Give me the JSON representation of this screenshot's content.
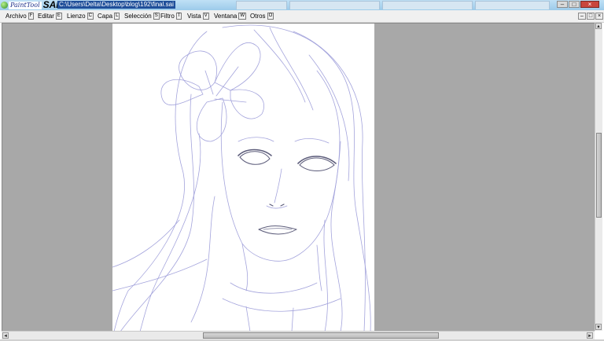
{
  "titlebar": {
    "logo_text": "PaintTool",
    "app_name": "SAI",
    "file_path": "C:\\Users\\Delta\\Desktop\\blog\\192\\final.sai"
  },
  "menu": {
    "items": [
      {
        "label": "Archivo",
        "key": "F"
      },
      {
        "label": "Editar",
        "key": "E"
      },
      {
        "label": "Lienzo",
        "key": "C"
      },
      {
        "label": "Capa",
        "key": "L"
      },
      {
        "label": "Selección",
        "key": "S"
      },
      {
        "label": "Filtro",
        "key": "T"
      },
      {
        "label": "Vista",
        "key": "V"
      },
      {
        "label": "Ventana",
        "key": "W"
      },
      {
        "label": "Otros",
        "key": "O"
      }
    ]
  },
  "window_controls": {
    "minimize": "–",
    "maximize": "□",
    "close": "×"
  },
  "colors": {
    "workspace_bg": "#a8a8a8",
    "canvas_bg": "#ffffff",
    "sketch_line": "#9a9ad8",
    "sketch_dark": "#5a5a78"
  },
  "scroll": {
    "up": "▲",
    "down": "▼",
    "left": "◄",
    "right": "►"
  }
}
